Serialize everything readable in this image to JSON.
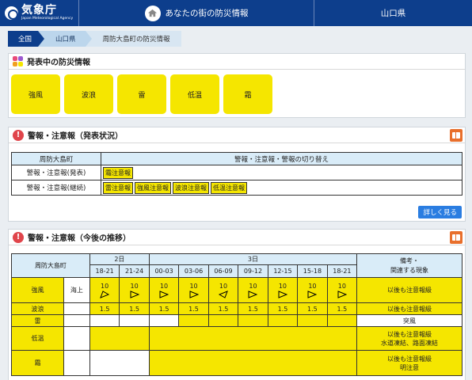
{
  "header": {
    "logo_ja": "気象庁",
    "logo_en": "Japan Meteorological Agency",
    "title": "あなたの街の防災情報",
    "prefecture": "山口県"
  },
  "breadcrumb": [
    "全国",
    "山口県",
    "周防大島町の防災情報"
  ],
  "active_info": {
    "title": "発表中の防災情報",
    "items": [
      "強風",
      "波浪",
      "雷",
      "低温",
      "霜"
    ]
  },
  "status": {
    "title": "警報・注意報（発表状況）",
    "col_area": "周防大島町",
    "col_switch": "警報・注意報・警報の切り替え",
    "row_issued": "警報・注意報(発表)",
    "row_continued": "警報・注意報(継続)",
    "issued_chips": [
      "霜注意報"
    ],
    "continued_chips": [
      "雷注意報",
      "強風注意報",
      "波浪注意報",
      "低温注意報"
    ],
    "more_button": "詳しく見る"
  },
  "forecast": {
    "title": "警報・注意報（今後の推移）",
    "area": "周防大島町",
    "day1": "2日",
    "day2": "3日",
    "remarks_header": "備考・\n関連する現象",
    "times": [
      "18-21",
      "21-24",
      "00-03",
      "03-06",
      "06-09",
      "09-12",
      "12-15",
      "15-18",
      "18-21"
    ],
    "rows": {
      "wind": {
        "label": "強風",
        "sublabel": "海上",
        "speeds": [
          "10",
          "10",
          "10",
          "10",
          "10",
          "10",
          "10",
          "10",
          "10"
        ],
        "remark": "以後も注意報級"
      },
      "wave": {
        "label": "波浪",
        "values": [
          "1.5",
          "1.5",
          "1.5",
          "1.5",
          "1.5",
          "1.5",
          "1.5",
          "1.5",
          "1.5"
        ],
        "remark": "以後も注意報級"
      },
      "thunder": {
        "label": "雷",
        "remark": "突風"
      },
      "lowtemp": {
        "label": "低温",
        "remark_1": "以後も注意報級",
        "remark_2": "水道凍結、路面凍結"
      },
      "frost": {
        "label": "霜",
        "remark_1": "以後も注意報級",
        "remark_2": "明注意"
      }
    }
  },
  "colors": {
    "advisory": "#f5e600",
    "header_bg": "#0d3e8c",
    "table_head": "#d9ecf8",
    "button": "#2a7de1"
  }
}
